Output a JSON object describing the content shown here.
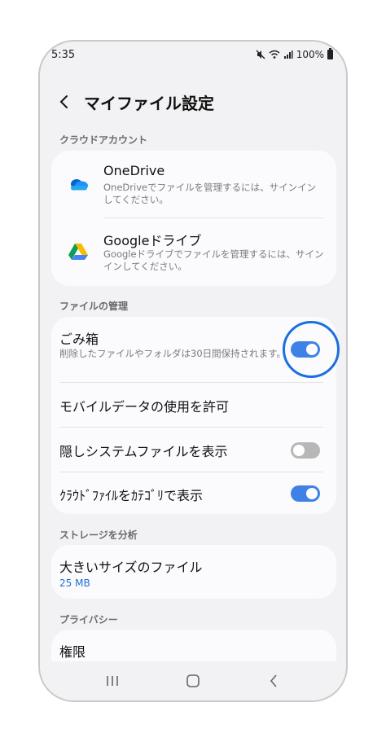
{
  "status_bar": {
    "time": "5:35",
    "battery": "100%"
  },
  "header": {
    "title": "マイファイル設定"
  },
  "sections": {
    "cloud": "クラウドアカウント",
    "manage": "ファイルの管理",
    "storage": "ストレージを分析",
    "privacy": "プライバシー"
  },
  "cloud_accounts": [
    {
      "title": "OneDrive",
      "subtitle": "OneDriveでファイルを管理するには、サインインしてください。"
    },
    {
      "title": "Googleドライブ",
      "subtitle": "Googleドライブでファイルを管理するには、サインインしてください。"
    }
  ],
  "file_management": {
    "trash": {
      "title": "ごみ箱",
      "subtitle": "削除したファイルやフォルダは30日間保持されます。",
      "enabled": true
    },
    "mobile_data": {
      "title": "モバイルデータの使用を許可"
    },
    "hidden_files": {
      "title": "隠しシステムファイルを表示",
      "enabled": false
    },
    "cloud_category": {
      "title": "ｸﾗｳﾄﾞﾌｧｲﾙをｶﾃｺﾞﾘで表示",
      "enabled": true
    }
  },
  "storage": {
    "large_files": {
      "title": "大きいサイズのファイル",
      "size": "25 MB"
    }
  },
  "privacy": {
    "permissions": {
      "title": "権限"
    }
  },
  "colors": {
    "accent": "#3f82e6",
    "highlight": "#1a6fe0",
    "link": "#1f6fd6"
  }
}
